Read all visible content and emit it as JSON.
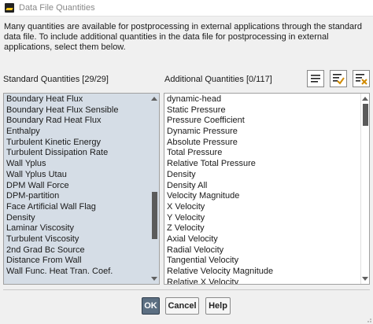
{
  "window": {
    "title": "Data File Quantities"
  },
  "description": "Many quantities are available for postprocessing in external applications through the standard data file. To include additional quantities in the data file for postprocessing in external applications, select them below.",
  "standard": {
    "label": "Standard Quantities [29/29]",
    "items": [
      "Boundary Heat Flux",
      "Boundary Heat Flux Sensible",
      "Boundary Rad Heat Flux",
      "Enthalpy",
      "Turbulent Kinetic Energy",
      "Turbulent Dissipation Rate",
      "Wall Yplus",
      "Wall Yplus Utau",
      "DPM Wall Force",
      "DPM-partition",
      "Face Artificial Wall Flag",
      "Density",
      "Laminar Viscosity",
      "Turbulent Viscosity",
      "2nd Grad Bc Source",
      "Distance From Wall",
      "Wall Func. Heat Tran. Coef."
    ],
    "scroll_fraction": 0.72
  },
  "additional": {
    "label": "Additional Quantities [0/117]",
    "items": [
      "dynamic-head",
      "Static Pressure",
      "Pressure Coefficient",
      "Dynamic Pressure",
      "Absolute Pressure",
      "Total Pressure",
      "Relative Total Pressure",
      "Density",
      "Density All",
      "Velocity Magnitude",
      "X Velocity",
      "Y Velocity",
      "Z Velocity",
      "Axial Velocity",
      "Radial Velocity",
      "Tangential Velocity",
      "Relative Velocity Magnitude",
      "Relative X Velocity"
    ],
    "scroll_fraction": 0.0
  },
  "toolbar": {
    "icons": [
      "select-all-icon",
      "select-checked-icon",
      "deselect-all-icon"
    ]
  },
  "buttons": {
    "ok": "OK",
    "cancel": "Cancel",
    "help": "Help"
  },
  "colors": {
    "selected_bg": "#d5dde6",
    "primary_button": "#5c6f82"
  }
}
